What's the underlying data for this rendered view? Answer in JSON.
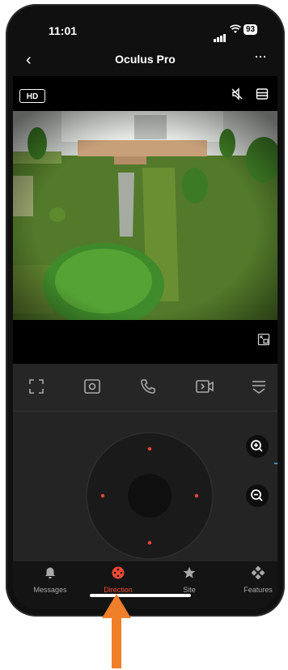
{
  "status_bar": {
    "time": "11:01",
    "battery": "93"
  },
  "header": {
    "title": "Oculus Pro"
  },
  "video": {
    "quality_badge": "HD"
  },
  "tabbar": {
    "tabs": [
      {
        "label": "Messages",
        "icon": "bell-icon",
        "active": false
      },
      {
        "label": "Direction",
        "icon": "direction-icon",
        "active": true
      },
      {
        "label": "Site",
        "icon": "star-icon",
        "active": false
      },
      {
        "label": "Features",
        "icon": "features-icon",
        "active": false
      }
    ]
  },
  "colors": {
    "accent": "#f04a33",
    "highlight": "#3c93c7",
    "annotation_arrow": "#f07f2a"
  }
}
